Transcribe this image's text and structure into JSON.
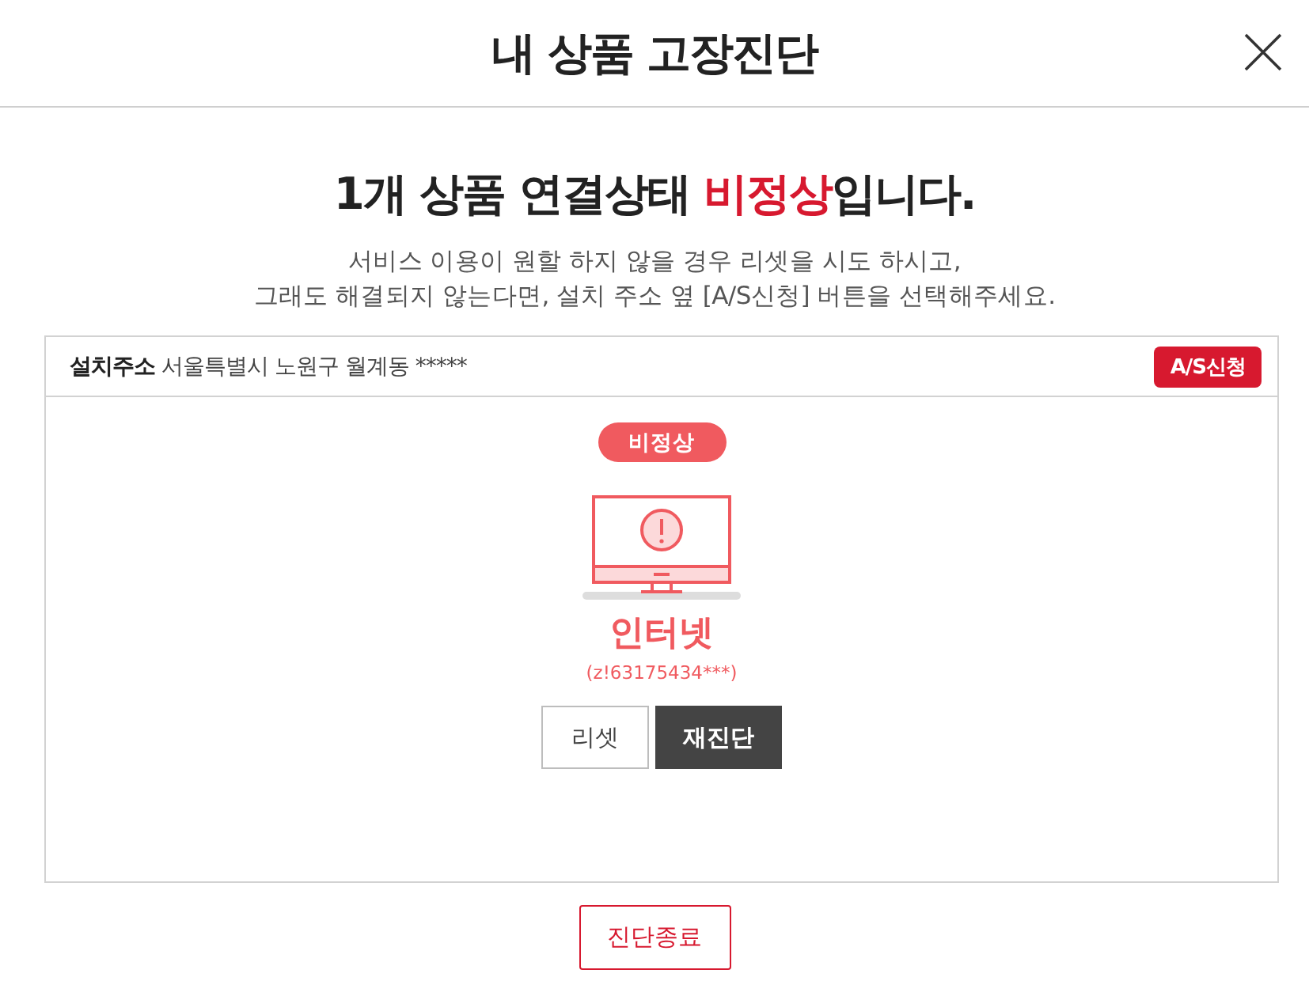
{
  "dialog": {
    "title": "내 상품 고장진단"
  },
  "summary": {
    "headline_before": "1개 상품 연결상태 ",
    "headline_highlight": "비정상",
    "headline_after": "입니다.",
    "description": [
      "서비스 이용이 원할 하지 않을 경우 리셋을 시도 하시고,",
      "그래도 해결되지 않는다면, 설치 주소 옆 [A/S신청] 버튼을 선택해주세요."
    ]
  },
  "address": {
    "label": "설치주소",
    "value": "서울특별시 노원구 월계동 *****",
    "button": "A/S신청"
  },
  "products": [
    {
      "abnormal": true,
      "status_label": "비정상",
      "name": "인터넷",
      "id": "(z!63175434***)",
      "buttons": [
        {
          "label": "리셋",
          "kind": "outline"
        },
        {
          "label": "재진단",
          "kind": "filled"
        }
      ]
    }
  ],
  "footer": {
    "button": "진단종료"
  }
}
